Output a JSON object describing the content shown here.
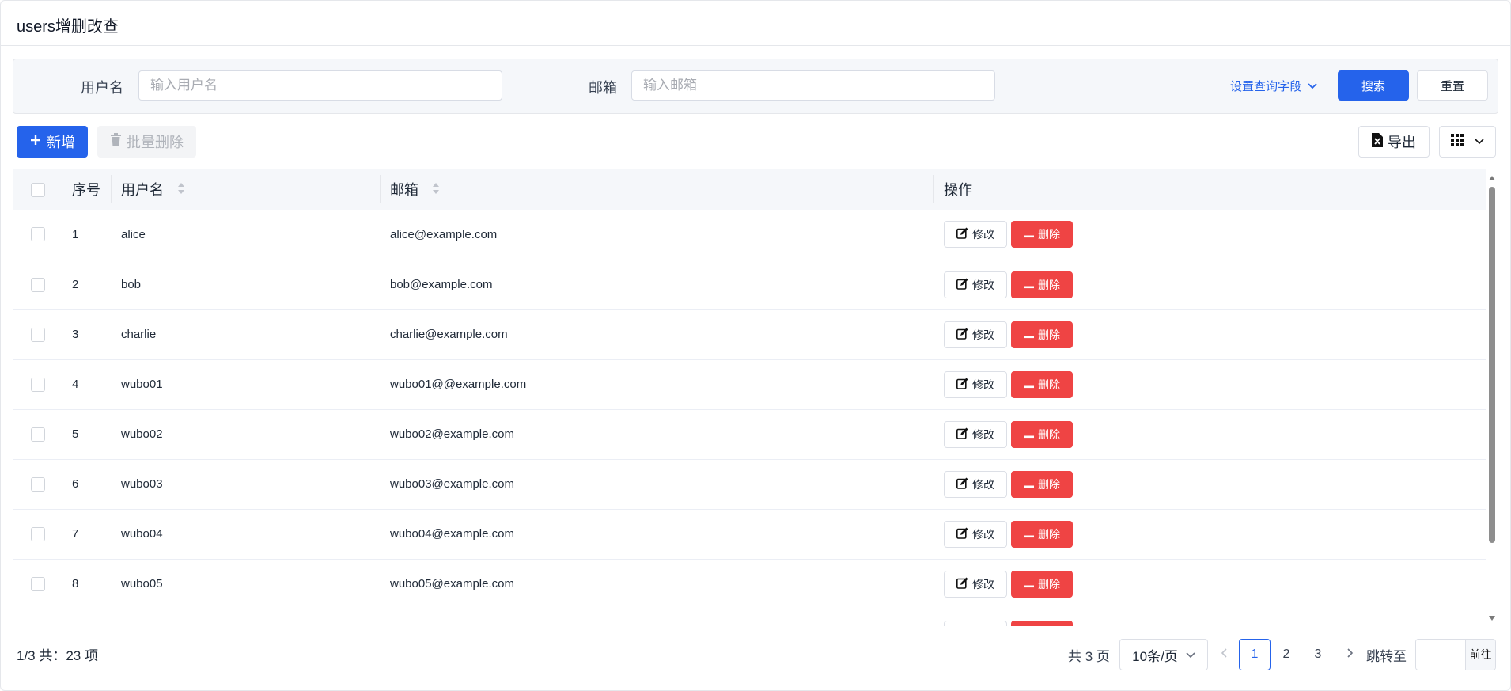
{
  "page": {
    "title": "users增删改查"
  },
  "search": {
    "username_label": "用户名",
    "username_placeholder": "输入用户名",
    "email_label": "邮箱",
    "email_placeholder": "输入邮箱",
    "set_fields_label": "设置查询字段",
    "search_button": "搜索",
    "reset_button": "重置"
  },
  "toolbar": {
    "add_label": "新增",
    "batch_delete_label": "批量删除",
    "export_label": "导出"
  },
  "table": {
    "columns": [
      "序号",
      "用户名",
      "邮箱",
      "操作"
    ],
    "edit_label": "修改",
    "delete_label": "删除",
    "rows": [
      {
        "index": "1",
        "username": "alice",
        "email": "alice@example.com"
      },
      {
        "index": "2",
        "username": "bob",
        "email": "bob@example.com"
      },
      {
        "index": "3",
        "username": "charlie",
        "email": "charlie@example.com"
      },
      {
        "index": "4",
        "username": "wubo01",
        "email": "wubo01@@example.com"
      },
      {
        "index": "5",
        "username": "wubo02",
        "email": "wubo02@example.com"
      },
      {
        "index": "6",
        "username": "wubo03",
        "email": "wubo03@example.com"
      },
      {
        "index": "7",
        "username": "wubo04",
        "email": "wubo04@example.com"
      },
      {
        "index": "8",
        "username": "wubo05",
        "email": "wubo05@example.com"
      }
    ]
  },
  "pagination": {
    "summary": "1/3 共：23 项",
    "total_pages": "共 3 页",
    "page_size": "10条/页",
    "pages": [
      "1",
      "2",
      "3"
    ],
    "current_page": "1",
    "jump_label": "跳转至",
    "go_label": "前往"
  },
  "colors": {
    "primary": "#2563eb",
    "danger": "#ef4444",
    "header_bg": "#f5f7fa"
  }
}
